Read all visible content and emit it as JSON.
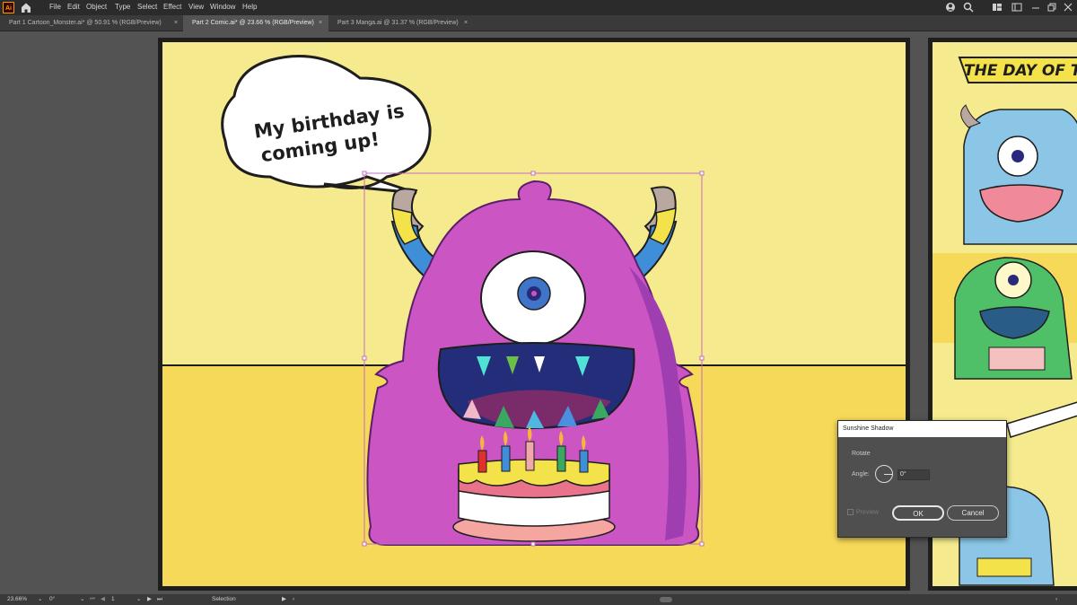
{
  "app": {
    "logo": "Ai"
  },
  "menu": [
    "File",
    "Edit",
    "Object",
    "Type",
    "Select",
    "Effect",
    "View",
    "Window",
    "Help"
  ],
  "tabs": [
    {
      "label": "Part 1 Cartoon_Monster.ai* @ 50.91 % (RGB/Preview)",
      "close": "×"
    },
    {
      "label": "Part 2 Comic.ai* @ 23.66 % (RGB/Preview)",
      "close": "×"
    },
    {
      "label": "Part 3 Manga.ai @ 31.37 % (RGB/Preview)",
      "close": "×"
    }
  ],
  "artwork": {
    "speech_line1": "My birthday is",
    "speech_line2": "coming up!",
    "title_banner": "THE DAY OF T"
  },
  "dialog": {
    "title": "Sunshine Shadow",
    "section": "Rotate",
    "angle_label": "Angle:",
    "angle_value": "0°",
    "preview_label": "Preview",
    "ok_label": "OK",
    "cancel_label": "Cancel"
  },
  "status": {
    "zoom": "23.66%",
    "rotation": "0°",
    "artboard": "1",
    "tool": "Selection"
  },
  "colors": {
    "menubar": "#2b2b2b",
    "canvas_bg": "#535353",
    "panel_top": "#f5eb8e",
    "panel_bottom": "#f7d95a",
    "monster": "#cc55c4",
    "selection": "#c26fbd"
  }
}
